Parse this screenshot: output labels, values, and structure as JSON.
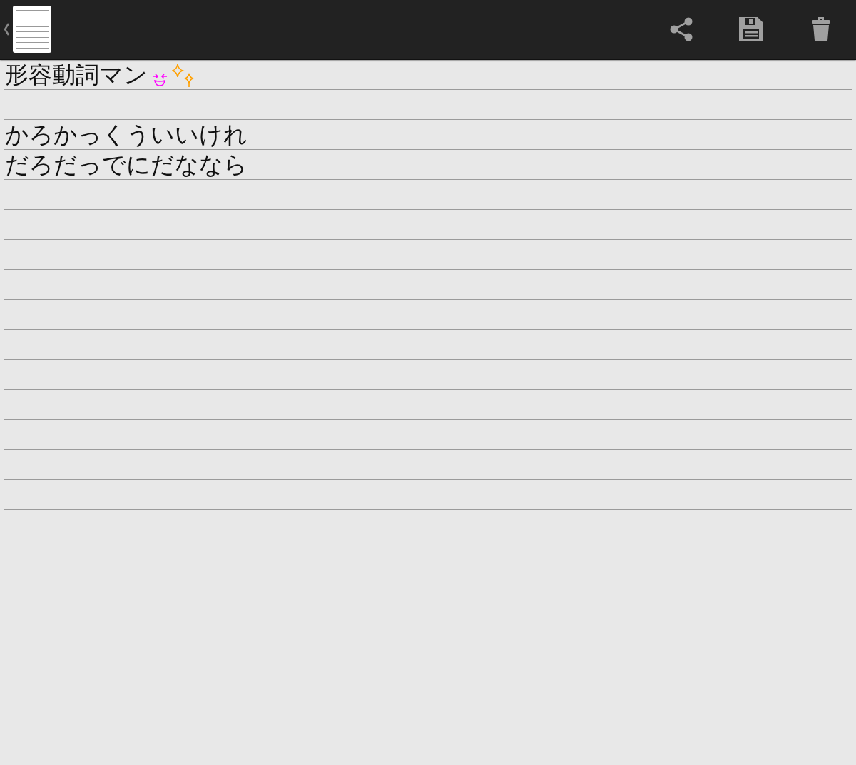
{
  "toolbar": {
    "actions": [
      {
        "kind": "share"
      },
      {
        "kind": "save"
      },
      {
        "kind": "delete"
      }
    ]
  },
  "note": {
    "lines": [
      {
        "kind": "title",
        "text": "形容動詞マン"
      },
      {
        "kind": "blank"
      },
      {
        "kind": "text",
        "text": "かろかっくういいけれ"
      },
      {
        "kind": "text",
        "text": "だろだっでにだななら"
      }
    ]
  }
}
